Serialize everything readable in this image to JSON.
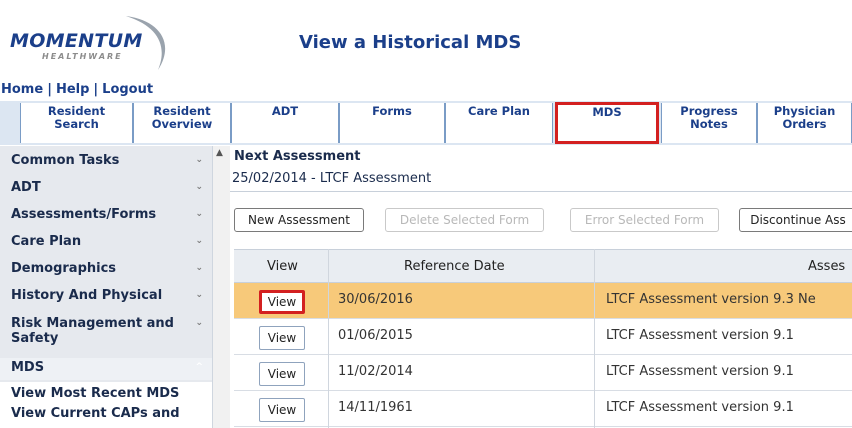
{
  "header": {
    "logo_line1": "MOMENTUM",
    "logo_line2": "HEALTHWARE",
    "title": "View a Historical MDS",
    "links": [
      "Home",
      "Help",
      "Logout"
    ],
    "separator": "|"
  },
  "tabs": [
    {
      "line1": "Resident",
      "line2": "Search"
    },
    {
      "line1": "Resident",
      "line2": "Overview"
    },
    {
      "line1": "ADT",
      "line2": ""
    },
    {
      "line1": "Forms",
      "line2": ""
    },
    {
      "line1": "Care Plan",
      "line2": ""
    },
    {
      "line1": "MDS",
      "line2": "",
      "selected": true
    },
    {
      "line1": "Progress",
      "line2": "Notes"
    },
    {
      "line1": "Physician",
      "line2": "Orders"
    }
  ],
  "sidebar": {
    "items": [
      {
        "label": "Common Tasks"
      },
      {
        "label": "ADT"
      },
      {
        "label": "Assessments/Forms"
      },
      {
        "label": "Care Plan"
      },
      {
        "label": "Demographics"
      },
      {
        "label": "History And Physical"
      },
      {
        "label": "Risk Management and",
        "label2": "Safety"
      },
      {
        "label": "MDS",
        "expanded": true
      }
    ],
    "sub_items": [
      "View Most Recent MDS",
      "View Current CAPs and"
    ],
    "chevron_down": "⌄",
    "chevron_up": "^"
  },
  "main": {
    "next_assessment_label": "Next Assessment",
    "next_assessment_value": "25/02/2014 - LTCF Assessment",
    "buttons": {
      "new": "New Assessment",
      "delete": "Delete Selected Form",
      "error": "Error Selected Form",
      "discontinue": "Discontinue Ass"
    },
    "grid": {
      "columns": [
        "View",
        "Reference Date",
        "Asses"
      ],
      "view_label": "View",
      "rows": [
        {
          "date": "30/06/2016",
          "assessment": "LTCF Assessment version 9.3 Ne",
          "highlighted": true
        },
        {
          "date": "01/06/2015",
          "assessment": "LTCF Assessment version 9.1"
        },
        {
          "date": "11/02/2014",
          "assessment": "LTCF Assessment version 9.1"
        },
        {
          "date": "14/11/1961",
          "assessment": "LTCF Assessment version 9.1"
        }
      ]
    }
  },
  "colors": {
    "brand_blue": "#1b3f8a",
    "highlight_row": "#f7c97a",
    "callout_red": "#d32020"
  }
}
